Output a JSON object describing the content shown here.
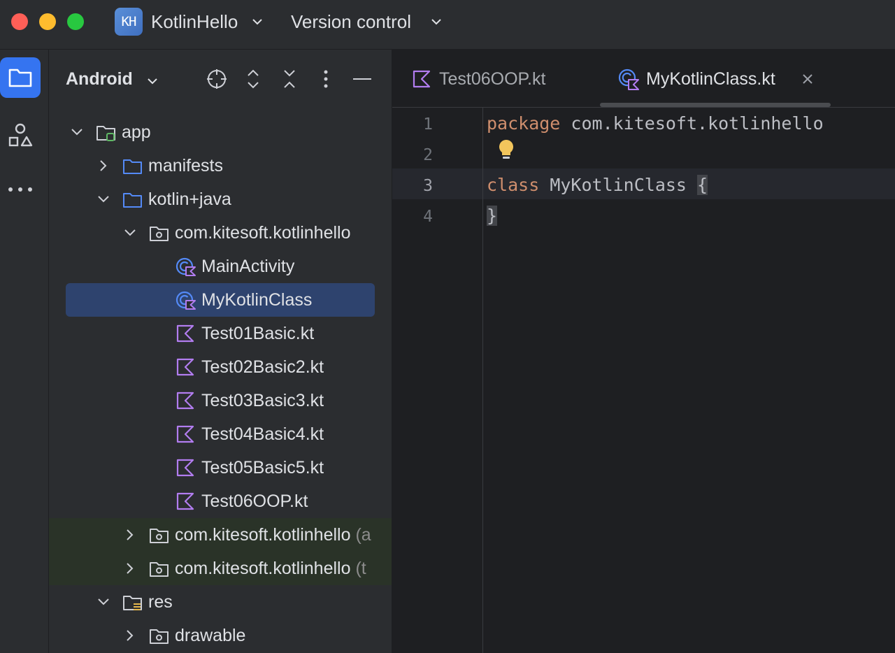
{
  "titlebar": {
    "project_badge": "KH",
    "project_name": "KotlinHello",
    "vcs_label": "Version control"
  },
  "stripe": {
    "items": [
      {
        "name": "project-icon",
        "active": true
      },
      {
        "name": "structure-icon",
        "active": false
      },
      {
        "name": "more-icon",
        "active": false
      }
    ]
  },
  "project_panel": {
    "view_label": "Android",
    "tools": [
      "locate-icon",
      "expand-all-icon",
      "collapse-all-icon",
      "options-icon",
      "hide-icon"
    ],
    "tree": [
      {
        "label": "app",
        "suffix": "",
        "level": 0,
        "expanded": true,
        "icon": "module-icon"
      },
      {
        "label": "manifests",
        "suffix": "",
        "level": 1,
        "expanded": false,
        "icon": "folder-icon"
      },
      {
        "label": "kotlin+java",
        "suffix": "",
        "level": 1,
        "expanded": true,
        "icon": "folder-icon"
      },
      {
        "label": "com.kitesoft.kotlinhello",
        "suffix": "",
        "level": 2,
        "expanded": true,
        "icon": "package-icon"
      },
      {
        "label": "MainActivity",
        "suffix": "",
        "level": 3,
        "icon": "kotlin-class-icon"
      },
      {
        "label": "MyKotlinClass",
        "suffix": "",
        "level": 3,
        "icon": "kotlin-class-icon",
        "selected": true
      },
      {
        "label": "Test01Basic.kt",
        "suffix": "",
        "level": 3,
        "icon": "kotlin-file-icon"
      },
      {
        "label": "Test02Basic2.kt",
        "suffix": "",
        "level": 3,
        "icon": "kotlin-file-icon"
      },
      {
        "label": "Test03Basic3.kt",
        "suffix": "",
        "level": 3,
        "icon": "kotlin-file-icon"
      },
      {
        "label": "Test04Basic4.kt",
        "suffix": "",
        "level": 3,
        "icon": "kotlin-file-icon"
      },
      {
        "label": "Test05Basic5.kt",
        "suffix": "",
        "level": 3,
        "icon": "kotlin-file-icon"
      },
      {
        "label": "Test06OOP.kt",
        "suffix": "",
        "level": 3,
        "icon": "kotlin-file-icon"
      },
      {
        "label": "com.kitesoft.kotlinhello",
        "suffix": " (a",
        "level": 2,
        "expanded": false,
        "icon": "package-icon",
        "test": true
      },
      {
        "label": "com.kitesoft.kotlinhello",
        "suffix": " (t",
        "level": 2,
        "expanded": false,
        "icon": "package-icon",
        "test": true
      },
      {
        "label": "res",
        "suffix": "",
        "level": 1,
        "expanded": true,
        "icon": "res-folder-icon"
      },
      {
        "label": "drawable",
        "suffix": "",
        "level": 2,
        "expanded": false,
        "icon": "package-icon"
      }
    ]
  },
  "editor": {
    "tabs": [
      {
        "label": "Test06OOP.kt",
        "icon": "kotlin-file-icon",
        "active": false
      },
      {
        "label": "MyKotlinClass.kt",
        "icon": "kotlin-class-icon",
        "active": true
      }
    ],
    "line_numbers": [
      "1",
      "2",
      "3",
      "4"
    ],
    "code": {
      "line1_keyword": "package",
      "line1_rest": " com.kitesoft.kotlinhello",
      "line3_keyword": "class",
      "line3_rest": " MyKotlinClass ",
      "line3_brace": "{",
      "line4_brace": "}"
    },
    "colors": {
      "keyword": "#cf8e6d",
      "text": "#bcbec4",
      "selection": "#2e436e"
    }
  }
}
